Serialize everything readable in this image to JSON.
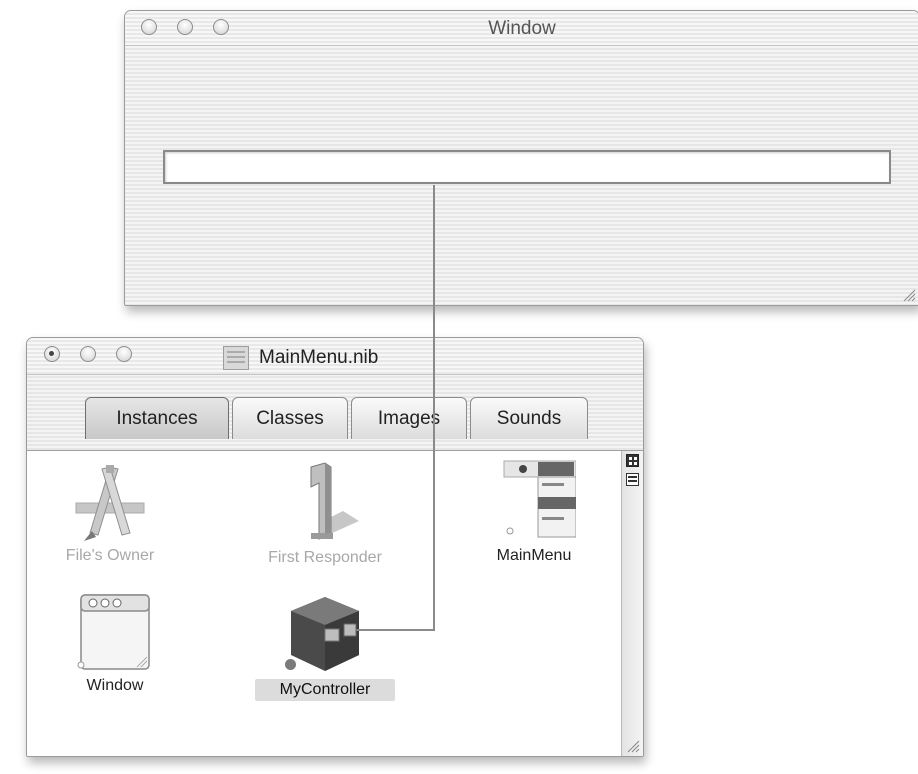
{
  "top_window": {
    "title": "Window",
    "controls": [
      "close",
      "minimize",
      "zoom"
    ]
  },
  "nib_window": {
    "title": "MainMenu.nib",
    "tabs": [
      {
        "label": "Instances",
        "active": true
      },
      {
        "label": "Classes",
        "active": false
      },
      {
        "label": "Images",
        "active": false
      },
      {
        "label": "Sounds",
        "active": false
      }
    ],
    "instances": [
      {
        "label": "File's Owner",
        "icon": "file-owner-icon"
      },
      {
        "label": "First Responder",
        "icon": "first-responder-icon"
      },
      {
        "label": "MainMenu",
        "icon": "main-menu-icon"
      },
      {
        "label": "Window",
        "icon": "window-instance-icon"
      },
      {
        "label": "MyController",
        "icon": "controller-cube-icon",
        "selected": true
      }
    ]
  },
  "colors": {
    "connection_line": "#8a8a8a",
    "dim_label": "#a8a8a8",
    "selection": "#dcdcdc"
  }
}
